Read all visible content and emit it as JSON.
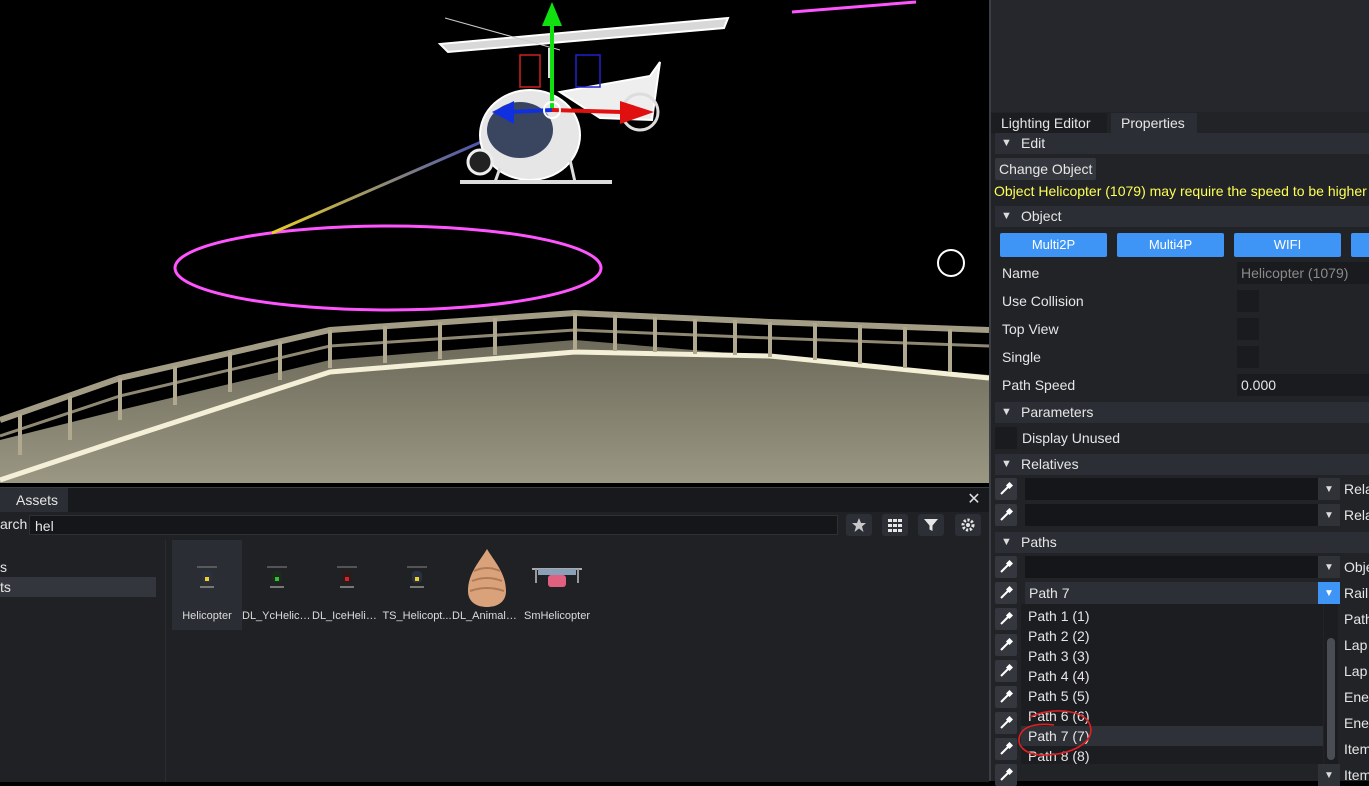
{
  "viewport": {},
  "assets_panel": {
    "tab_label": "Assets",
    "close_symbol": "✕",
    "search_label": "arch",
    "search_value": "hel",
    "left_items": [
      "s",
      "ts"
    ],
    "items": [
      {
        "label": "Helicopter",
        "icon": "helicopter-icon"
      },
      {
        "label": "DL_YcHelico...",
        "icon": "helicopter-icon"
      },
      {
        "label": "DL_IceHelico...",
        "icon": "helicopter-icon"
      },
      {
        "label": "TS_Helicopt...",
        "icon": "helicopter-icon"
      },
      {
        "label": "DL_AnimalS...",
        "icon": "shell-icon"
      },
      {
        "label": "SmHelicopter",
        "icon": "small-helicopter-icon"
      }
    ]
  },
  "right_panel": {
    "tabs": [
      "Lighting Editor",
      "Properties"
    ],
    "edit": {
      "section": "Edit",
      "change_object": "Change Object",
      "warning": "Object Helicopter (1079) may require the speed to be higher th"
    },
    "object": {
      "section": "Object",
      "buttons": [
        "Multi2P",
        "Multi4P",
        "WIFI"
      ],
      "name_label": "Name",
      "name_value": "Helicopter (1079)",
      "use_collision": "Use Collision",
      "top_view": "Top View",
      "single": "Single",
      "path_speed_label": "Path Speed",
      "path_speed_value": "0.000"
    },
    "parameters": {
      "section": "Parameters",
      "display_unused": "Display Unused"
    },
    "relatives": {
      "section": "Relatives",
      "side_label": "Rela"
    },
    "paths": {
      "section": "Paths",
      "labels": [
        "Obje",
        "Rail",
        "Path",
        "Lap",
        "Lap",
        "Ener",
        "Ener",
        "Item",
        "Item"
      ],
      "selected": "Path 7",
      "options": [
        "Path 1 (1)",
        "Path 2 (2)",
        "Path 3 (3)",
        "Path 4 (4)",
        "Path 5 (5)",
        "Path 6 (6)",
        "Path 7 (7)",
        "Path 8 (8)"
      ]
    }
  },
  "colors": {
    "accent": "#3f95f5",
    "warning": "#ffff55",
    "path_ring": "#ff55ff",
    "annotation": "#e02020"
  }
}
